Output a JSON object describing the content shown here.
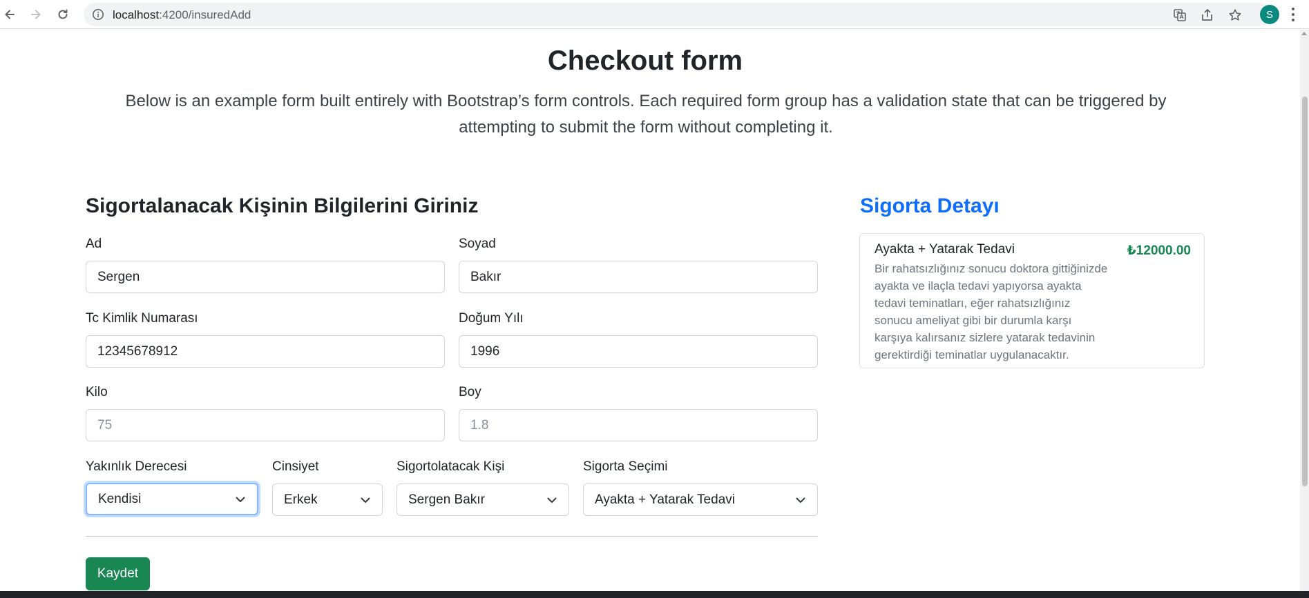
{
  "browser": {
    "url_host": "localhost",
    "url_path": ":4200/insuredAdd",
    "avatar_initial": "S"
  },
  "header": {
    "title": "Checkout form",
    "lead": "Below is an example form built entirely with Bootstrap’s form controls. Each required form group has a validation state that can be triggered by attempting to submit the form without completing it."
  },
  "form": {
    "section_title": "Sigortalanacak Kişinin Bilgilerini Giriniz",
    "first_name": {
      "label": "Ad",
      "value": "Sergen"
    },
    "last_name": {
      "label": "Soyad",
      "value": "Bakır"
    },
    "tc_no": {
      "label": "Tc Kimlik Numarası",
      "value": "12345678912"
    },
    "birth_year": {
      "label": "Doğum Yılı",
      "value": "1996"
    },
    "weight": {
      "label": "Kilo",
      "placeholder": "75"
    },
    "height": {
      "label": "Boy",
      "placeholder": "1.8"
    },
    "relation": {
      "label": "Yakınlık Derecesi",
      "selected": "Kendisi"
    },
    "gender": {
      "label": "Cinsiyet",
      "selected": "Erkek"
    },
    "insured_person": {
      "label": "Sigortolatacak Kişi",
      "selected": "Sergen Bakır"
    },
    "insurance_choice": {
      "label": "Sigorta Seçimi",
      "selected": "Ayakta + Yatarak Tedavi"
    },
    "save_label": "Kaydet"
  },
  "aside": {
    "title": "Sigorta Detayı",
    "card_title": "Ayakta + Yatarak Tedavi",
    "card_price": "₺12000.00",
    "card_desc": "Bir rahatsızlığınız sonucu doktora gittiğinizde ayakta ve ilaçla tedavi yapıyorsa ayakta tedavi teminatları, eğer rahatsızlığınız sonucu ameliyat gibi bir durumla karşı karşıya kalırsanız sizlere yatarak tedavinin gerektirdiği teminatlar uygulanacaktır."
  },
  "colors": {
    "accent_blue": "#0d6efd",
    "success_green": "#198754",
    "avatar_teal": "#0b8a7f"
  },
  "icons": [
    "back-arrow-icon",
    "forward-arrow-icon",
    "reload-icon",
    "info-icon",
    "translate-icon",
    "share-icon",
    "star-icon",
    "kebab-menu-icon",
    "chevron-down-icon"
  ]
}
